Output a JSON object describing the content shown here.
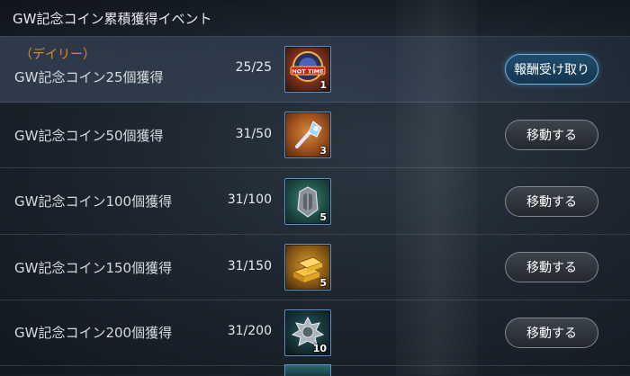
{
  "header": {
    "title": "GW記念コイン累積獲得イベント"
  },
  "rows": [
    {
      "tag": "（デイリー）",
      "title": "GW記念コイン25個獲得",
      "progress": "25/25",
      "item_icon": "hot-time-icon",
      "item_count": "1",
      "button": "報酬受け取り"
    },
    {
      "title": "GW記念コイン50個獲得",
      "progress": "31/50",
      "item_icon": "glowing-key-icon",
      "item_count": "3",
      "button": "移動する"
    },
    {
      "title": "GW記念コイン100個獲得",
      "progress": "31/100",
      "item_icon": "armor-chest-icon",
      "item_count": "5",
      "button": "移動する"
    },
    {
      "title": "GW記念コイン150個獲得",
      "progress": "31/150",
      "item_icon": "gold-bars-icon",
      "item_count": "5",
      "button": "移動する"
    },
    {
      "title": "GW記念コイン200個獲得",
      "progress": "31/200",
      "item_icon": "silver-crest-icon",
      "item_count": "10",
      "button": "移動する"
    }
  ],
  "colors": {
    "tag": "#e08a2a",
    "item_border": "#5a92c9",
    "claim_button_border": "#6fb2df"
  }
}
